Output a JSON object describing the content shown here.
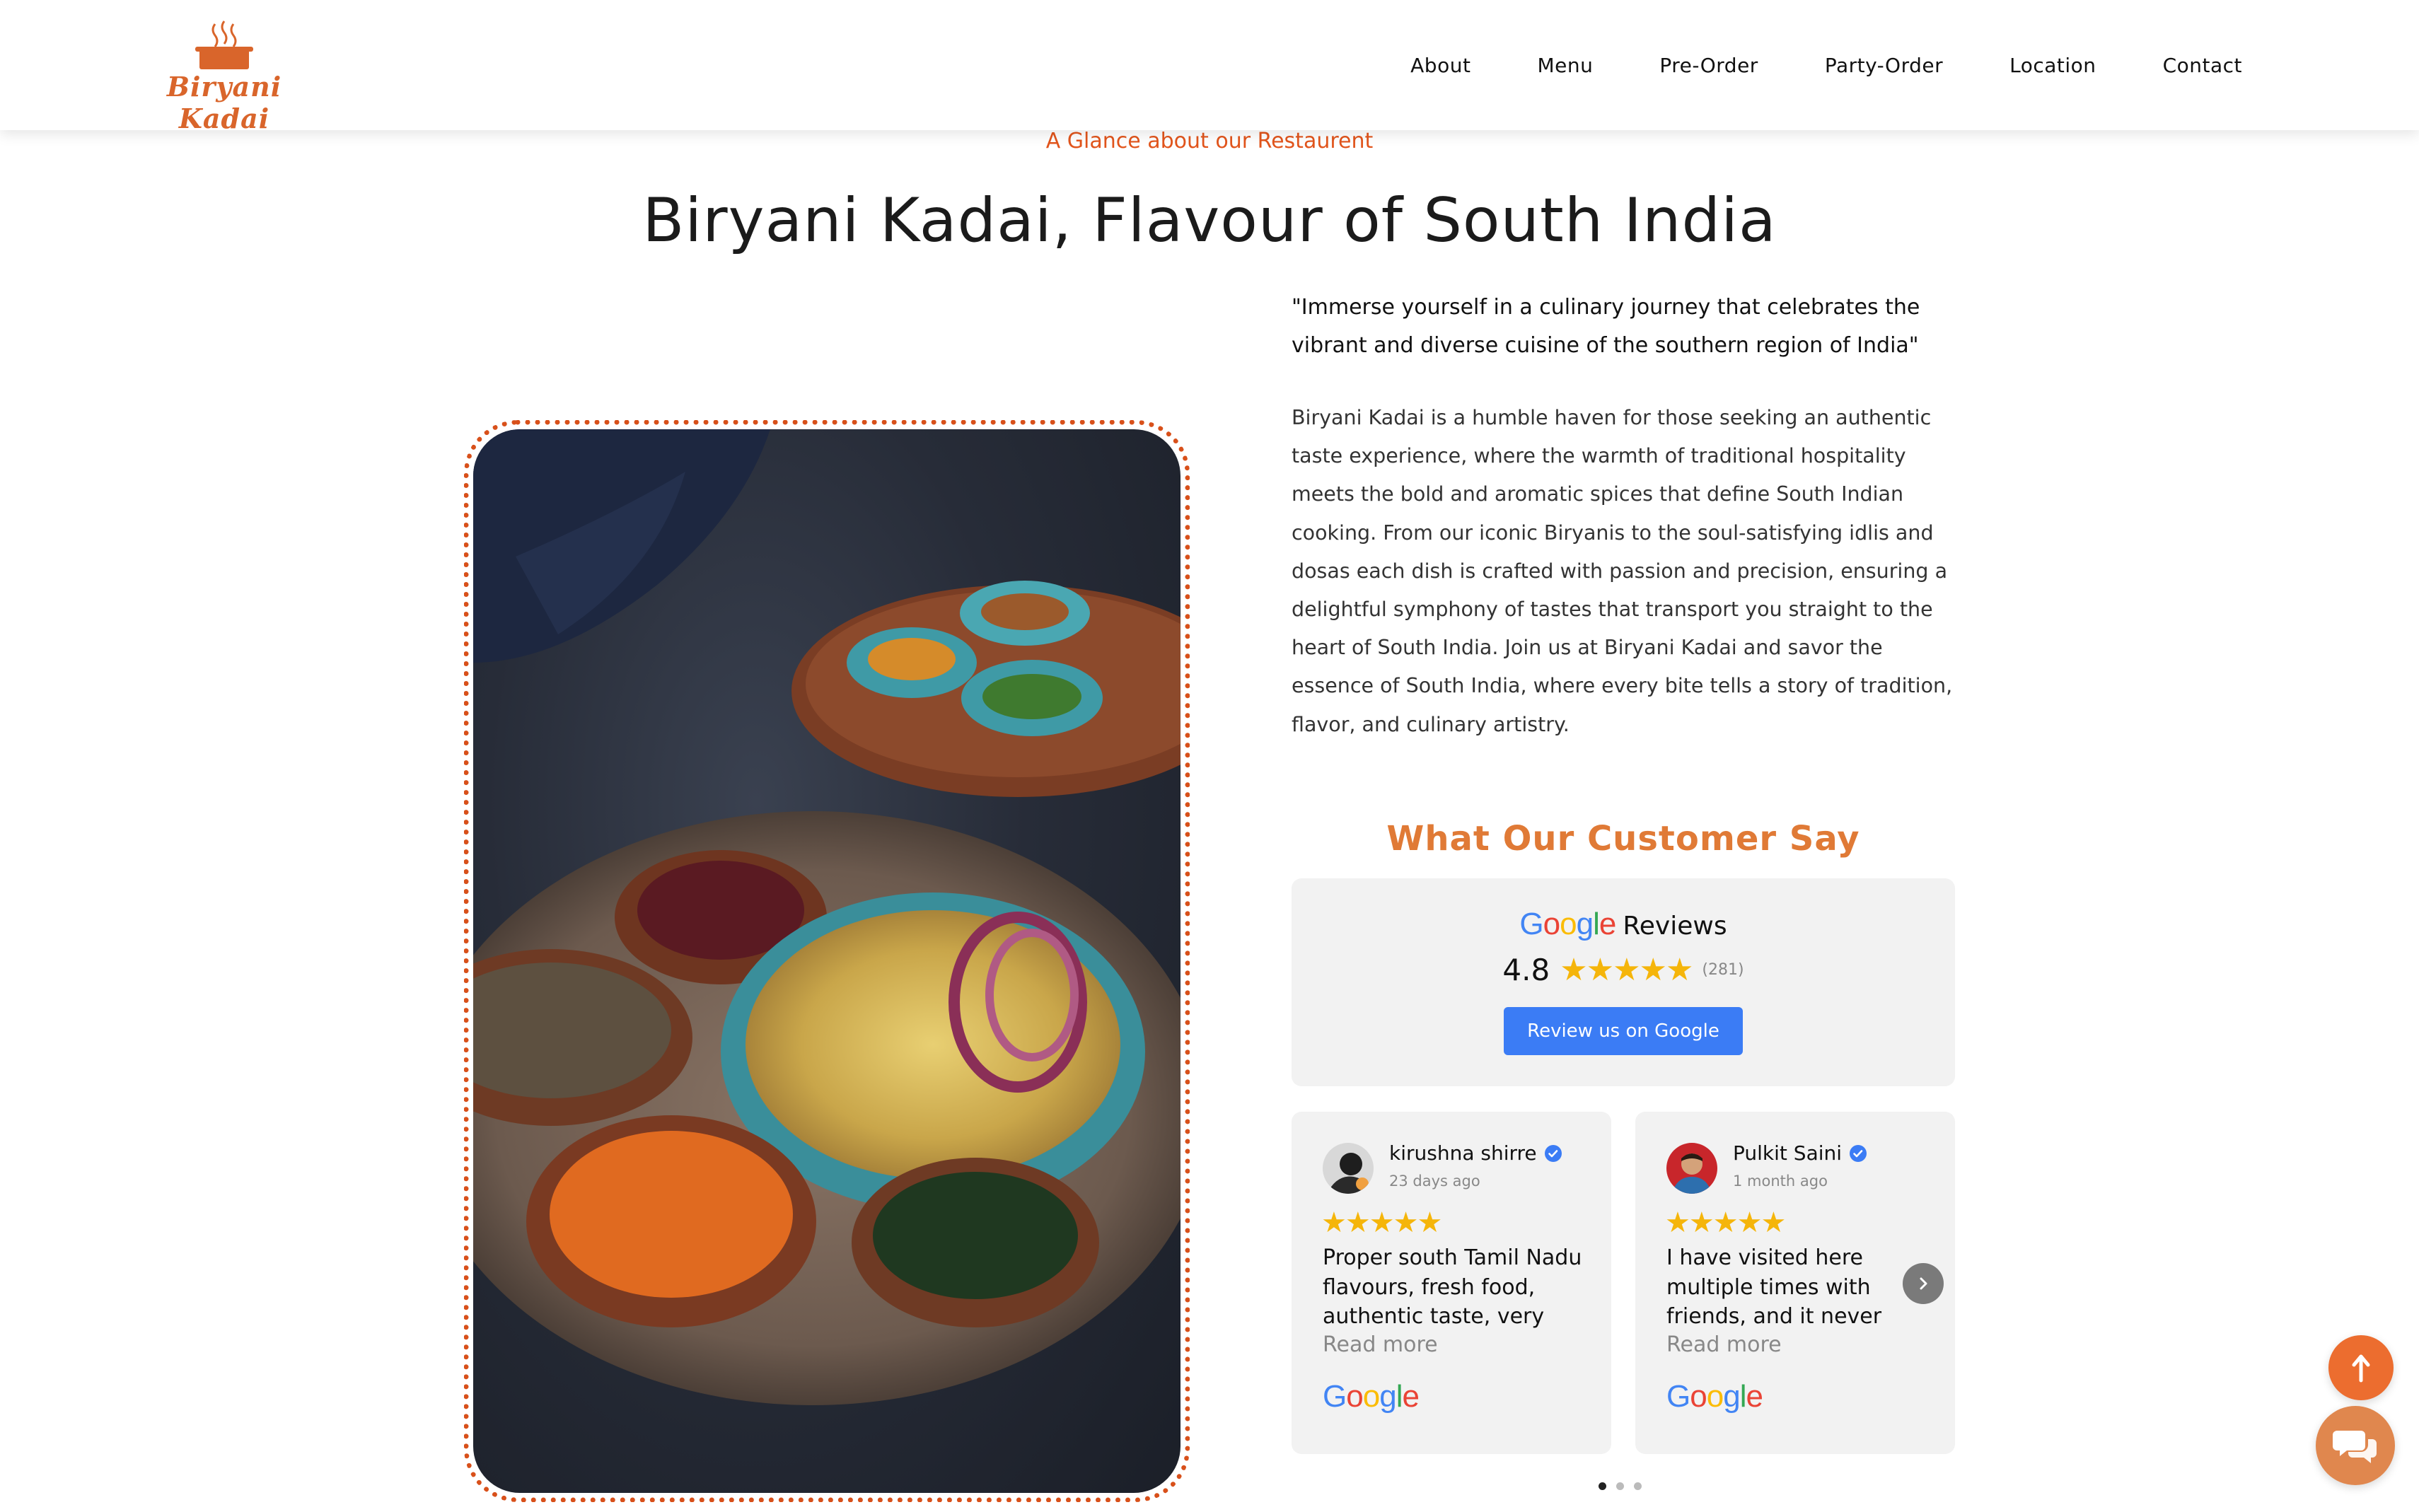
{
  "header": {
    "logo_text": "Biryani Kadai",
    "nav": [
      "About",
      "Menu",
      "Pre-Order",
      "Party-Order",
      "Location",
      "Contact"
    ]
  },
  "intro": {
    "eyebrow": "A Glance about our Restaurent",
    "title": "Biryani Kadai, Flavour of South India",
    "quote": "\"Immerse yourself in a culinary journey that celebrates the vibrant and diverse cuisine of the southern region of India\"",
    "body": "Biryani Kadai is a humble haven for those seeking an authentic taste experience, where the warmth of traditional hospitality meets the bold and aromatic spices that define South Indian cooking. From our iconic Biryanis to the soul-satisfying idlis and dosas each dish is crafted with passion and precision, ensuring a delightful symphony of tastes that transport you straight to the heart of South India. Join us at Biryani Kadai and savor the essence of South India, where every bite tells a story of tradition, flavor, and culinary artistry."
  },
  "reviews": {
    "title": "What Our Customer Say",
    "summary": {
      "brand": "Google",
      "label": "Reviews",
      "rating": "4.8",
      "stars": 5,
      "count": "(281)",
      "button": "Review us on Google"
    },
    "cards": [
      {
        "name": "kirushna shirre",
        "when": "23 days ago",
        "stars": "★★★★★",
        "text": "Proper south Tamil Nadu flavours, fresh food, authentic taste, very",
        "read_more": "Read more",
        "source": "Google"
      },
      {
        "name": "Pulkit Saini",
        "when": "1 month ago",
        "stars": "★★★★★",
        "text": "I have visited here multiple times with friends, and it never",
        "read_more": "Read more",
        "source": "Google"
      }
    ],
    "pagination": {
      "pages": 3,
      "active": 1
    }
  },
  "colors": {
    "accent": "#e2551c",
    "reviews_title": "#e07a36",
    "google_button": "#3b7cf5",
    "star": "#f5b50a",
    "card_bg": "#f2f2f2"
  },
  "icons": [
    "steaming-pot-icon",
    "verified-check-icon",
    "chevron-right-icon",
    "arrow-up-icon",
    "chat-bubbles-icon"
  ]
}
